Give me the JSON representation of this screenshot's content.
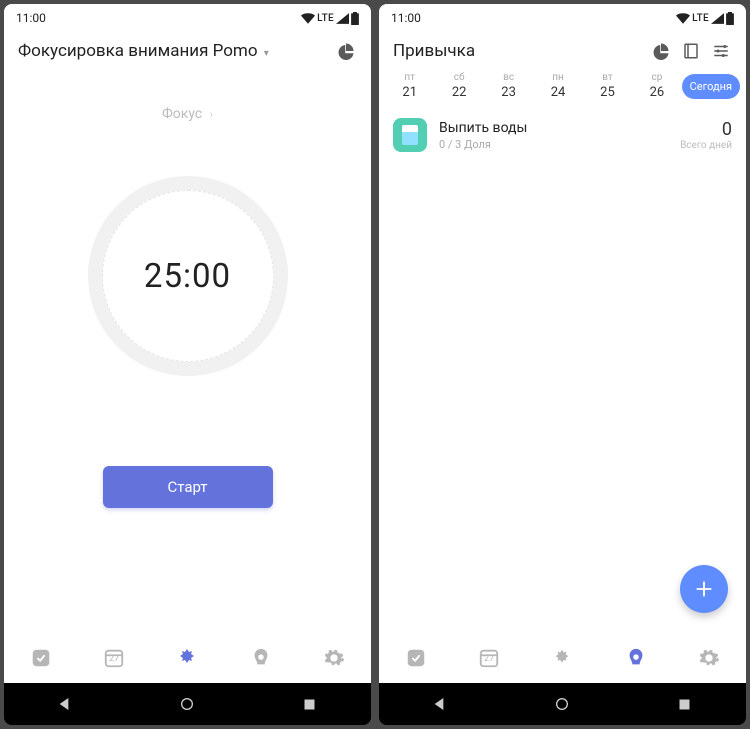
{
  "status": {
    "time": "11:00",
    "net": "LTE"
  },
  "screen1": {
    "title": "Фокусировка внимания Pomo",
    "focus_label": "Фокус",
    "timer": "25:00",
    "start": "Старт",
    "nav_cal": "27"
  },
  "screen2": {
    "title": "Привычка",
    "days": [
      {
        "name": "пт",
        "num": "21"
      },
      {
        "name": "сб",
        "num": "22"
      },
      {
        "name": "вс",
        "num": "23"
      },
      {
        "name": "пн",
        "num": "24"
      },
      {
        "name": "вт",
        "num": "25"
      },
      {
        "name": "ср",
        "num": "26"
      }
    ],
    "today": "Сегодня",
    "habit": {
      "title": "Выпить воды",
      "sub": "0 / 3 Доля",
      "count": "0",
      "count_label": "Всего дней"
    },
    "nav_cal": "27"
  }
}
